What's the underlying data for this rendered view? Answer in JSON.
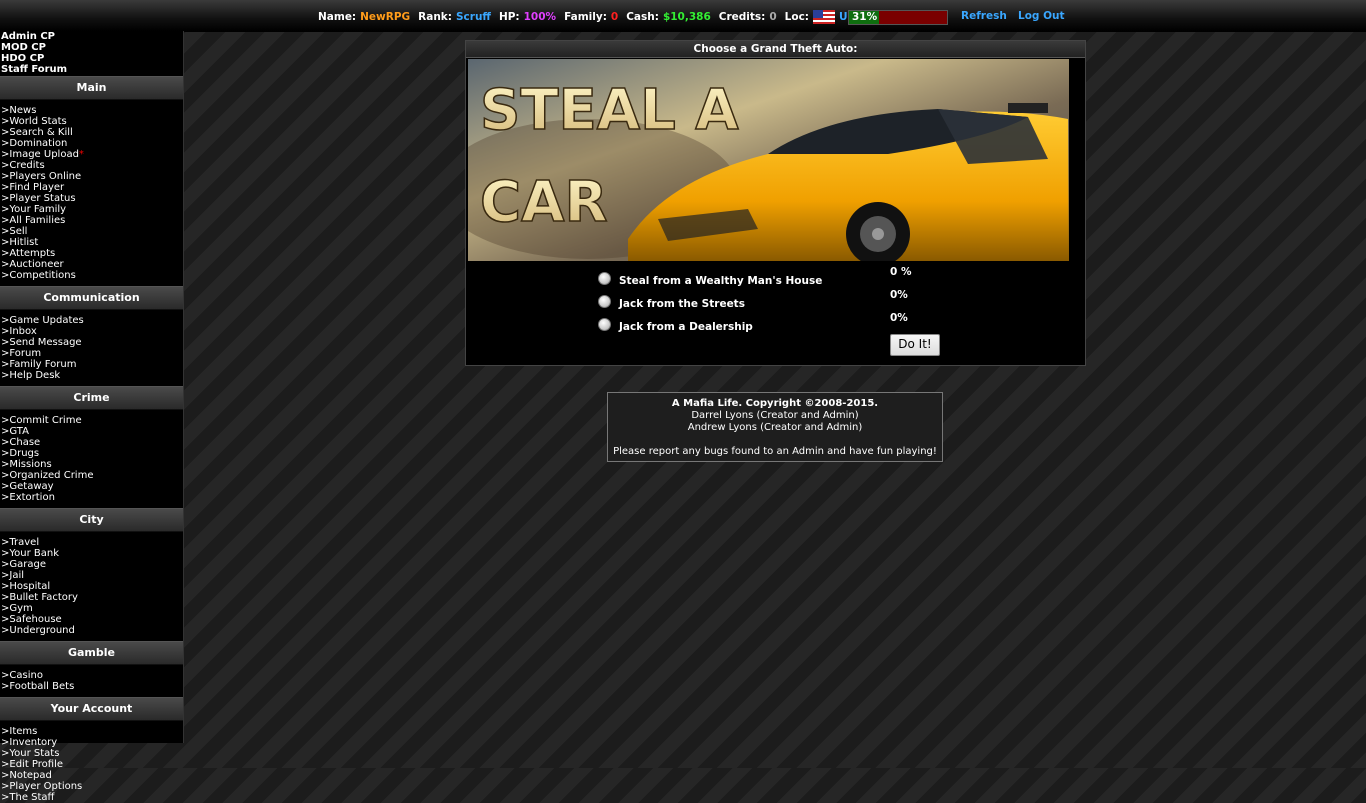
{
  "topbar": {
    "name_label": "Name:",
    "name_value": "NewRPG",
    "rank_label": "Rank:",
    "rank_value": "Scruff",
    "hp_label": "HP:",
    "hp_value": "100%",
    "family_label": "Family:",
    "family_value": "0",
    "cash_label": "Cash:",
    "cash_value": "$10,386",
    "credits_label": "Credits:",
    "credits_value": "0",
    "loc_label": "Loc:",
    "loc_value": "USA",
    "progress_text": "31%",
    "progress_fraction": 0.31,
    "refresh": "Refresh",
    "logout": "Log Out",
    "colors": {
      "name": "#ff9c1a",
      "rank": "#3aa7ff",
      "hp": "#e040ff",
      "family": "#ff2020",
      "cash": "#33ee33",
      "credits": "#aaaaaa",
      "loc": "#3aa7ff"
    }
  },
  "sidebar": {
    "cp_links": [
      "Admin CP",
      "MOD CP",
      "HDO CP",
      "Staff Forum"
    ],
    "sections": [
      {
        "title": "Main",
        "items": [
          ">News",
          ">World Stats",
          ">Search & Kill",
          ">Domination",
          ">Image Upload",
          ">Credits",
          ">Players Online",
          ">Find Player",
          ">Player Status",
          ">Your Family",
          ">All Families",
          ">Sell",
          ">Hitlist",
          ">Attempts",
          ">Auctioneer",
          ">Competitions"
        ]
      },
      {
        "title": "Communication",
        "items": [
          ">Game Updates",
          ">Inbox",
          ">Send Message",
          ">Forum",
          ">Family Forum",
          ">Help Desk"
        ]
      },
      {
        "title": "Crime",
        "items": [
          ">Commit Crime",
          ">GTA",
          ">Chase",
          ">Drugs",
          ">Missions",
          ">Organized Crime",
          ">Getaway",
          ">Extortion"
        ]
      },
      {
        "title": "City",
        "items": [
          ">Travel",
          ">Your Bank",
          ">Garage",
          ">Jail",
          ">Hospital",
          ">Bullet Factory",
          ">Gym",
          ">Safehouse",
          ">Underground"
        ]
      },
      {
        "title": "Gamble",
        "items": [
          ">Casino",
          ">Football Bets"
        ]
      },
      {
        "title": "Your Account",
        "items": [
          ">Items",
          ">Inventory",
          ">Your Stats",
          ">Edit Profile",
          ">Notepad",
          ">Player Options",
          ">The Staff"
        ]
      }
    ],
    "new_marker": "*"
  },
  "panel": {
    "title": "Choose a Grand Theft Auto:",
    "banner_line1": "STEAL A",
    "banner_line2": "CAR",
    "options": [
      {
        "label": "Steal from a Wealthy Man's House",
        "chance": "0 %"
      },
      {
        "label": "Jack from the Streets",
        "chance": "0%"
      },
      {
        "label": "Jack from a Dealership",
        "chance": "0%"
      }
    ],
    "button": "Do It!"
  },
  "footer": {
    "line1": "A Mafia Life. Copyright ©2008-2015.",
    "line2": "Darrel Lyons (Creator and Admin)",
    "line3": "Andrew Lyons (Creator and Admin)",
    "line4": "Please report any bugs found to an Admin and have fun playing!"
  }
}
